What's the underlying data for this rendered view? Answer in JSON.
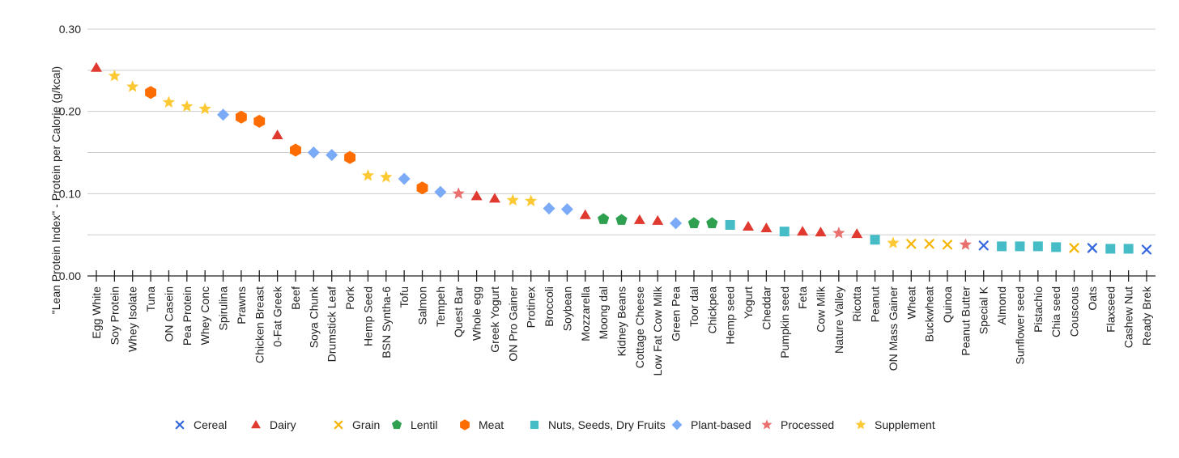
{
  "chart_data": {
    "type": "scatter",
    "title": "",
    "xlabel": "",
    "ylabel": "\"Lean Protein Index\" - Protein per Calorie (g/kcal)",
    "ylim": [
      0,
      0.3
    ],
    "yticks": [
      "0.00",
      "0.10",
      "0.20",
      "0.30"
    ],
    "ytick_values": [
      0,
      0.1,
      0.2,
      0.3
    ],
    "minor_gridlines": [
      0.05,
      0.15,
      0.25
    ],
    "grid": true,
    "legend_position": "bottom",
    "categories_legend": [
      {
        "name": "Cereal",
        "shape": "x-mark",
        "color": "#3366dd"
      },
      {
        "name": "Dairy",
        "shape": "triangle",
        "color": "#e03a30"
      },
      {
        "name": "Grain",
        "shape": "x-mark",
        "color": "#f5b400"
      },
      {
        "name": "Lentil",
        "shape": "pentagon",
        "color": "#2ea04f"
      },
      {
        "name": "Meat",
        "shape": "hexagon",
        "color": "#ff6d01"
      },
      {
        "name": "Nuts, Seeds, Dry Fruits",
        "shape": "square",
        "color": "#46bdc6"
      },
      {
        "name": "Plant-based",
        "shape": "diamond",
        "color": "#7baaf7"
      },
      {
        "name": "Processed",
        "shape": "star",
        "color": "#ea7070"
      },
      {
        "name": "Supplement",
        "shape": "star",
        "color": "#fcc934"
      }
    ],
    "points": [
      {
        "x": "Egg White",
        "y": 0.253,
        "group": "Dairy"
      },
      {
        "x": "Soy Protein",
        "y": 0.243,
        "group": "Supplement"
      },
      {
        "x": "Whey Isolate",
        "y": 0.23,
        "group": "Supplement"
      },
      {
        "x": "Tuna",
        "y": 0.223,
        "group": "Meat"
      },
      {
        "x": "ON Casein",
        "y": 0.211,
        "group": "Supplement"
      },
      {
        "x": "Pea Protein",
        "y": 0.206,
        "group": "Supplement"
      },
      {
        "x": "Whey Conc",
        "y": 0.203,
        "group": "Supplement"
      },
      {
        "x": "Spirulina",
        "y": 0.196,
        "group": "Plant-based"
      },
      {
        "x": "Prawns",
        "y": 0.193,
        "group": "Meat"
      },
      {
        "x": "Chicken Breast",
        "y": 0.188,
        "group": "Meat"
      },
      {
        "x": "0-Fat Greek",
        "y": 0.171,
        "group": "Dairy"
      },
      {
        "x": "Beef",
        "y": 0.153,
        "group": "Meat"
      },
      {
        "x": "Soya Chunk",
        "y": 0.15,
        "group": "Plant-based"
      },
      {
        "x": "Drumstick Leaf",
        "y": 0.147,
        "group": "Plant-based"
      },
      {
        "x": "Pork",
        "y": 0.144,
        "group": "Meat"
      },
      {
        "x": "Hemp Seed",
        "y": 0.122,
        "group": "Supplement"
      },
      {
        "x": "BSN Syntha-6",
        "y": 0.12,
        "group": "Supplement"
      },
      {
        "x": "Tofu",
        "y": 0.118,
        "group": "Plant-based"
      },
      {
        "x": "Salmon",
        "y": 0.107,
        "group": "Meat"
      },
      {
        "x": "Tempeh",
        "y": 0.102,
        "group": "Plant-based"
      },
      {
        "x": "Quest Bar",
        "y": 0.1,
        "group": "Processed"
      },
      {
        "x": "Whole egg",
        "y": 0.097,
        "group": "Dairy"
      },
      {
        "x": "Greek Yogurt",
        "y": 0.094,
        "group": "Dairy"
      },
      {
        "x": "ON Pro Gainer",
        "y": 0.092,
        "group": "Supplement"
      },
      {
        "x": "Protinex",
        "y": 0.091,
        "group": "Supplement"
      },
      {
        "x": "Broccoli",
        "y": 0.082,
        "group": "Plant-based"
      },
      {
        "x": "Soybean",
        "y": 0.081,
        "group": "Plant-based"
      },
      {
        "x": "Mozzarella",
        "y": 0.074,
        "group": "Dairy"
      },
      {
        "x": "Moong dal",
        "y": 0.069,
        "group": "Lentil"
      },
      {
        "x": "Kidney Beans",
        "y": 0.068,
        "group": "Lentil"
      },
      {
        "x": "Cottage Cheese",
        "y": 0.068,
        "group": "Dairy"
      },
      {
        "x": "Low Fat Cow Milk",
        "y": 0.067,
        "group": "Dairy"
      },
      {
        "x": "Green Pea",
        "y": 0.064,
        "group": "Plant-based"
      },
      {
        "x": "Toor dal",
        "y": 0.064,
        "group": "Lentil"
      },
      {
        "x": "Chickpea",
        "y": 0.064,
        "group": "Lentil"
      },
      {
        "x": "Hemp seed",
        "y": 0.062,
        "group": "Nuts, Seeds, Dry Fruits"
      },
      {
        "x": "Yogurt",
        "y": 0.06,
        "group": "Dairy"
      },
      {
        "x": "Cheddar",
        "y": 0.058,
        "group": "Dairy"
      },
      {
        "x": "Pumpkin seed",
        "y": 0.054,
        "group": "Nuts, Seeds, Dry Fruits"
      },
      {
        "x": "Feta",
        "y": 0.054,
        "group": "Dairy"
      },
      {
        "x": "Cow Milk",
        "y": 0.053,
        "group": "Dairy"
      },
      {
        "x": "Nature Valley",
        "y": 0.052,
        "group": "Processed"
      },
      {
        "x": "Ricotta",
        "y": 0.051,
        "group": "Dairy"
      },
      {
        "x": "Peanut",
        "y": 0.044,
        "group": "Nuts, Seeds, Dry Fruits"
      },
      {
        "x": "ON Mass Gainer",
        "y": 0.04,
        "group": "Supplement"
      },
      {
        "x": "Wheat",
        "y": 0.039,
        "group": "Grain"
      },
      {
        "x": "Buckwheat",
        "y": 0.039,
        "group": "Grain"
      },
      {
        "x": "Quinoa",
        "y": 0.038,
        "group": "Grain"
      },
      {
        "x": "Peanut Butter",
        "y": 0.038,
        "group": "Processed"
      },
      {
        "x": "Special K",
        "y": 0.037,
        "group": "Cereal"
      },
      {
        "x": "Almond",
        "y": 0.036,
        "group": "Nuts, Seeds, Dry Fruits"
      },
      {
        "x": "Sunflower seed",
        "y": 0.036,
        "group": "Nuts, Seeds, Dry Fruits"
      },
      {
        "x": "Pistachio",
        "y": 0.036,
        "group": "Nuts, Seeds, Dry Fruits"
      },
      {
        "x": "Chia seed",
        "y": 0.035,
        "group": "Nuts, Seeds, Dry Fruits"
      },
      {
        "x": "Couscous",
        "y": 0.034,
        "group": "Grain"
      },
      {
        "x": "Oats",
        "y": 0.034,
        "group": "Cereal"
      },
      {
        "x": "Flaxseed",
        "y": 0.033,
        "group": "Nuts, Seeds, Dry Fruits"
      },
      {
        "x": "Cashew Nut",
        "y": 0.033,
        "group": "Nuts, Seeds, Dry Fruits"
      },
      {
        "x": "Ready Brek",
        "y": 0.032,
        "group": "Cereal"
      }
    ]
  }
}
